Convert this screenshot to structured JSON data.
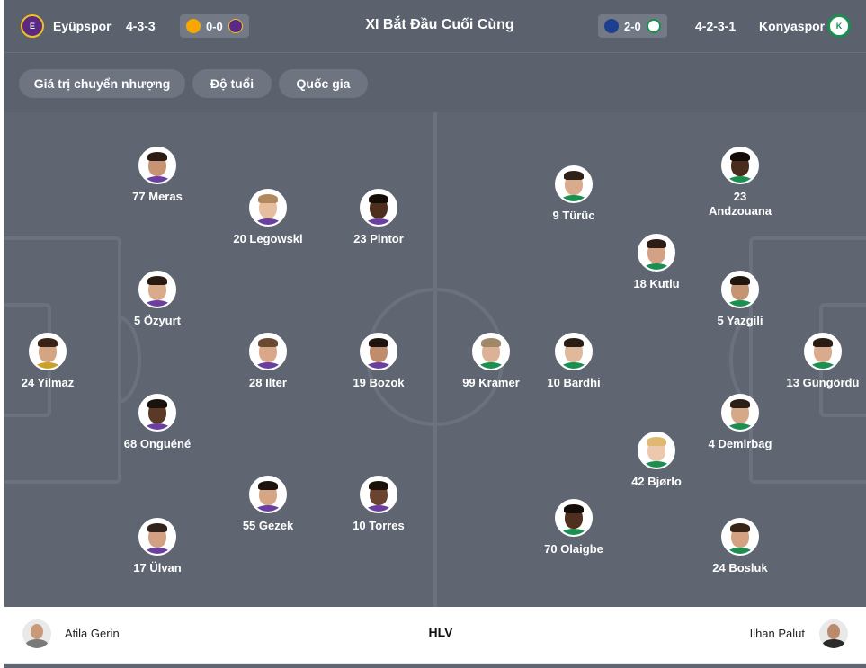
{
  "header": {
    "home_team": "Eyüpspor",
    "home_formation": "4-3-3",
    "home_last_score": "0-0",
    "title": "XI Bắt Đầu Cuối Cùng",
    "away_last_score": "2-0",
    "away_formation": "4-2-3-1",
    "away_team": "Konyaspor"
  },
  "filters": [
    "Giá trị chuyển nhượng",
    "Độ tuổi",
    "Quốc gia"
  ],
  "home_players": [
    {
      "id": "yilmaz",
      "label": "24 Yilmaz"
    },
    {
      "id": "meras",
      "label": "77 Meras"
    },
    {
      "id": "ozyurt",
      "label": "5 Özyurt"
    },
    {
      "id": "onguene",
      "label": "68 Onguéné"
    },
    {
      "id": "ulvan",
      "label": "17 Ülvan"
    },
    {
      "id": "legowski",
      "label": "20 Legowski"
    },
    {
      "id": "ilter",
      "label": "28 Ilter"
    },
    {
      "id": "gezek",
      "label": "55 Gezek"
    },
    {
      "id": "pintor",
      "label": "23 Pintor"
    },
    {
      "id": "bozok",
      "label": "19 Bozok"
    },
    {
      "id": "torres",
      "label": "10 Torres"
    }
  ],
  "away_players": [
    {
      "id": "kramer",
      "label": "99 Kramer"
    },
    {
      "id": "turuc",
      "label": "9 Türüc"
    },
    {
      "id": "bardhi",
      "label": "10 Bardhi"
    },
    {
      "id": "olaigbe",
      "label": "70 Olaigbe"
    },
    {
      "id": "kutlu",
      "label": "18 Kutlu"
    },
    {
      "id": "bjorlo",
      "label": "42 Bjørlo"
    },
    {
      "id": "andzouana",
      "label": "23\nAndzouana"
    },
    {
      "id": "yazgili",
      "label": "5 Yazgili"
    },
    {
      "id": "demirbag",
      "label": "4 Demirbag"
    },
    {
      "id": "bosluk",
      "label": "24 Bosluk"
    },
    {
      "id": "gungordu",
      "label": "13 Güngördü"
    }
  ],
  "coaches": {
    "home": "Atila Gerin",
    "label": "HLV",
    "away": "Ilhan Palut"
  },
  "colors": {
    "pitch": "#5f6672",
    "pitch_lines": "#6b727d",
    "topbar": "#5b626d",
    "pill": "#6e7581",
    "home_crest": "#5a2a82",
    "away_crest": "#1a8f4f"
  }
}
